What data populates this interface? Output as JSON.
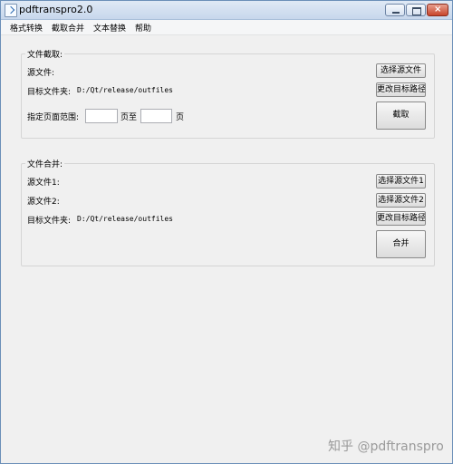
{
  "window": {
    "title": "pdftranspro2.0"
  },
  "menu": [
    "格式转换",
    "截取合并",
    "文本替换",
    "帮助"
  ],
  "extract": {
    "group_title": "文件截取:",
    "source_label": "源文件:",
    "target_label": "目标文件夹:",
    "target_path": "D:/Qt/release/outfiles",
    "range_label": "指定页面范围:",
    "page_to": "页至",
    "page_unit": "页",
    "range_start": "",
    "range_end": "",
    "select_source_button": "选择源文件",
    "change_target_button": "更改目标路径",
    "extract_button": "截取"
  },
  "merge": {
    "group_title": "文件合并:",
    "source1_label": "源文件1:",
    "source2_label": "源文件2:",
    "target_label": "目标文件夹:",
    "target_path": "D:/Qt/release/outfiles",
    "select_source1_button": "选择源文件1",
    "select_source2_button": "选择源文件2",
    "change_target_button": "更改目标路径",
    "merge_button": "合并"
  },
  "watermark": "知乎 @pdftranspro"
}
